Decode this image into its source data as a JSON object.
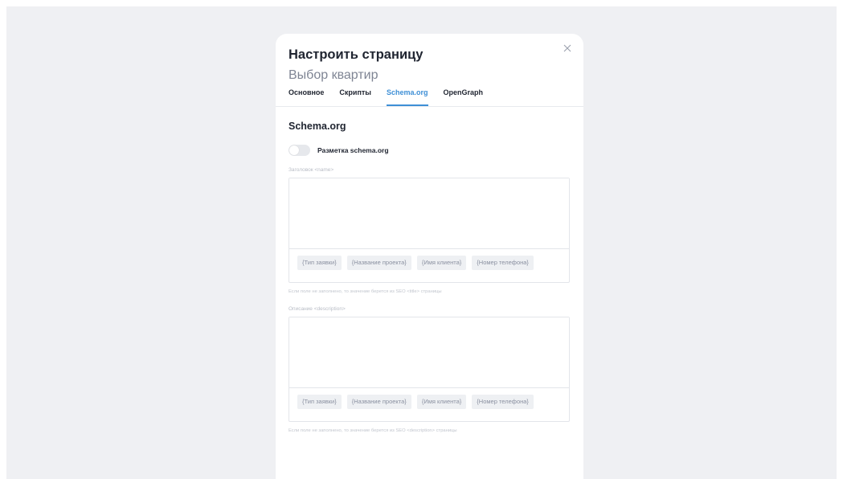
{
  "modal": {
    "title": "Настроить страницу",
    "subtitle": "Выбор квартир",
    "close_icon": "close-icon"
  },
  "tabs": [
    {
      "label": "Основное",
      "active": false
    },
    {
      "label": "Скрипты",
      "active": false
    },
    {
      "label": "Schema.org",
      "active": true
    },
    {
      "label": "OpenGraph",
      "active": false
    }
  ],
  "section": {
    "title": "Schema.org",
    "toggle_label": "Разметка schema.org",
    "toggle_on": false
  },
  "fields": [
    {
      "label": "Заголовок <name>",
      "value": "",
      "chips": [
        "{Тип заявки}",
        "{Название проекта}",
        "{Имя клиента}",
        "{Номер телефона}"
      ],
      "hint": "Если поле не заполнено, то значение берется из SEO <title> страницы"
    },
    {
      "label": "Описание <description>",
      "value": "",
      "chips": [
        "{Тип заявки}",
        "{Название проекта}",
        "{Имя клиента}",
        "{Номер телефона}"
      ],
      "hint": "Если поле не заполнено, то значение берется из SEO <description> страницы"
    }
  ],
  "colors": {
    "accent": "#3e8fd6",
    "backdrop": "#eff0f3"
  }
}
